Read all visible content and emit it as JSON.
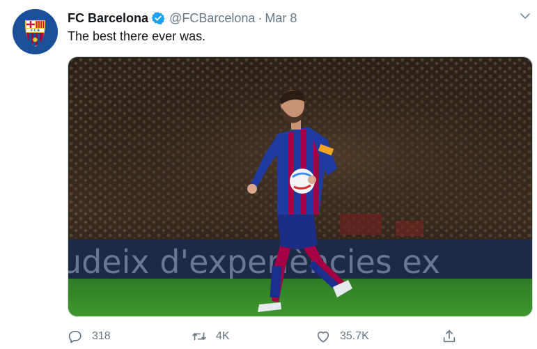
{
  "tweet": {
    "display_name": "FC Barcelona",
    "handle": "@FCBarcelona",
    "separator": "·",
    "date": "Mar 8",
    "text": "The best there ever was.",
    "verified": true
  },
  "media": {
    "banner_text": "udeix d'experiències ex"
  },
  "actions": {
    "replies": "318",
    "retweets": "4K",
    "likes": "35.7K"
  },
  "colors": {
    "text": "#14171a",
    "muted": "#657786",
    "verified_blue": "#1da1f2",
    "barca_blue": "#0a4d9c",
    "barca_red": "#a50044",
    "pitch_green": "#3d8f2c"
  },
  "icons": {
    "avatar": "fc-barcelona-crest",
    "verified": "verified-badge-icon",
    "menu": "chevron-down-icon",
    "reply": "reply-icon",
    "retweet": "retweet-icon",
    "like": "heart-icon",
    "share": "share-icon"
  }
}
